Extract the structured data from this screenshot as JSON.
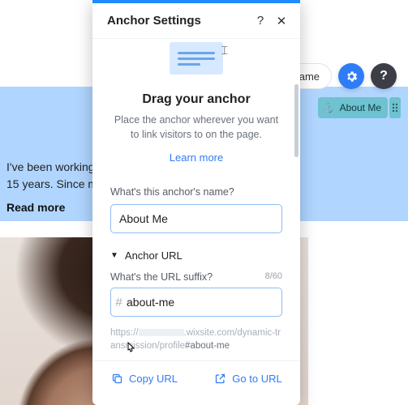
{
  "background": {
    "text_line1": "I've been working",
    "text_line2": "15 years. Since m",
    "read_more": "Read more"
  },
  "toolbar": {
    "rename": "Rename",
    "gear_icon": "gear-icon",
    "help_icon": "help-icon",
    "help_glyph": "?"
  },
  "anchor_tag": {
    "icon": "⚓",
    "label": "About Me"
  },
  "panel": {
    "title": "Anchor Settings",
    "help_glyph": "?",
    "close_glyph": "✕",
    "drag_heading": "Drag your anchor",
    "drag_sub": "Place the anchor wherever you want to link visitors to on the page.",
    "learn_more": "Learn more",
    "name_label": "What's this anchor's name?",
    "name_value": "About Me",
    "url_section": "Anchor URL",
    "suffix_label": "What's the URL suffix?",
    "suffix_counter": "8/60",
    "suffix_hash": "#",
    "suffix_value": "about-me",
    "full_url_prefix": "https://",
    "full_url_mid": ".wixsite.com/dynamic-transmission/profile",
    "full_url_frag": "#about-me",
    "copy_url": "Copy URL",
    "go_to_url": "Go to URL"
  }
}
